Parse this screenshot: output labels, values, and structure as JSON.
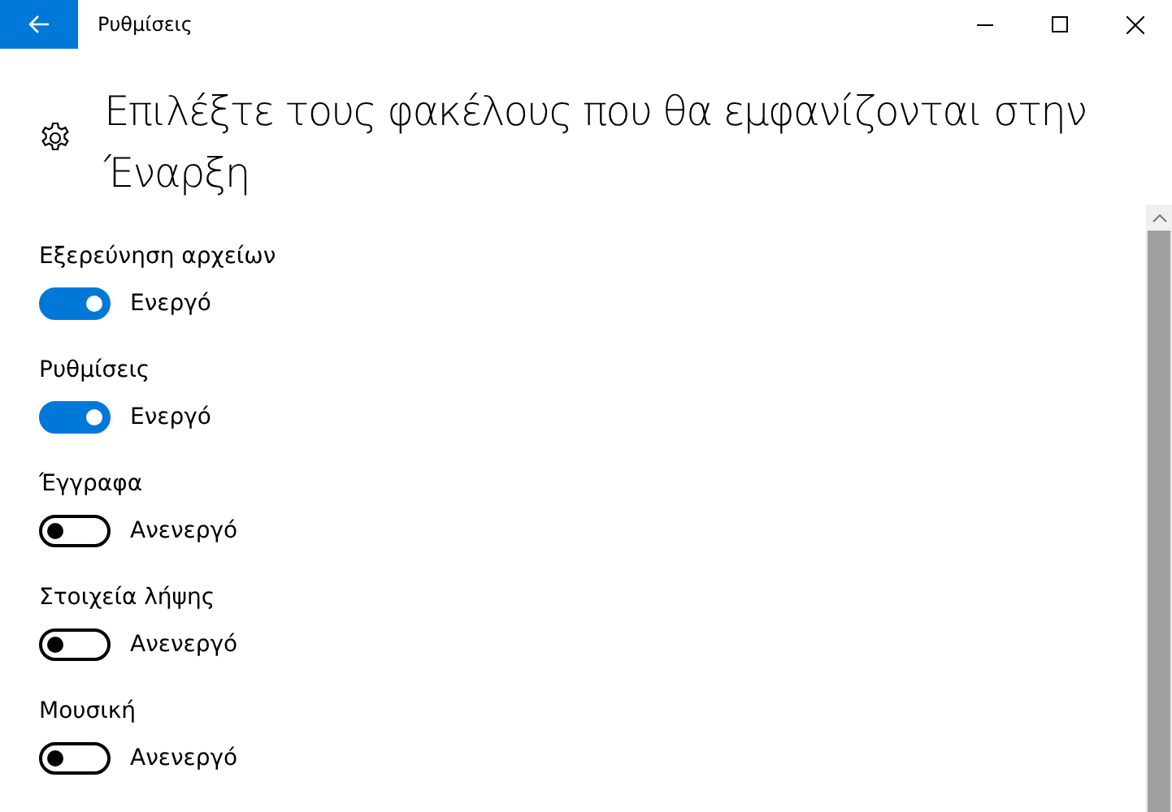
{
  "window": {
    "title": "Ρυθμίσεις"
  },
  "page": {
    "heading": "Επιλέξτε τους φακέλους που θα εμφανίζονται στην Έναρξη"
  },
  "settings": [
    {
      "label": "Εξερεύνηση αρχείων",
      "on": true,
      "status": "Ενεργό"
    },
    {
      "label": "Ρυθμίσεις",
      "on": true,
      "status": "Ενεργό"
    },
    {
      "label": "Έγγραφα",
      "on": false,
      "status": "Ανενεργό"
    },
    {
      "label": "Στοιχεία λήψης",
      "on": false,
      "status": "Ανενεργό"
    },
    {
      "label": "Μουσική",
      "on": false,
      "status": "Ανενεργό"
    }
  ]
}
